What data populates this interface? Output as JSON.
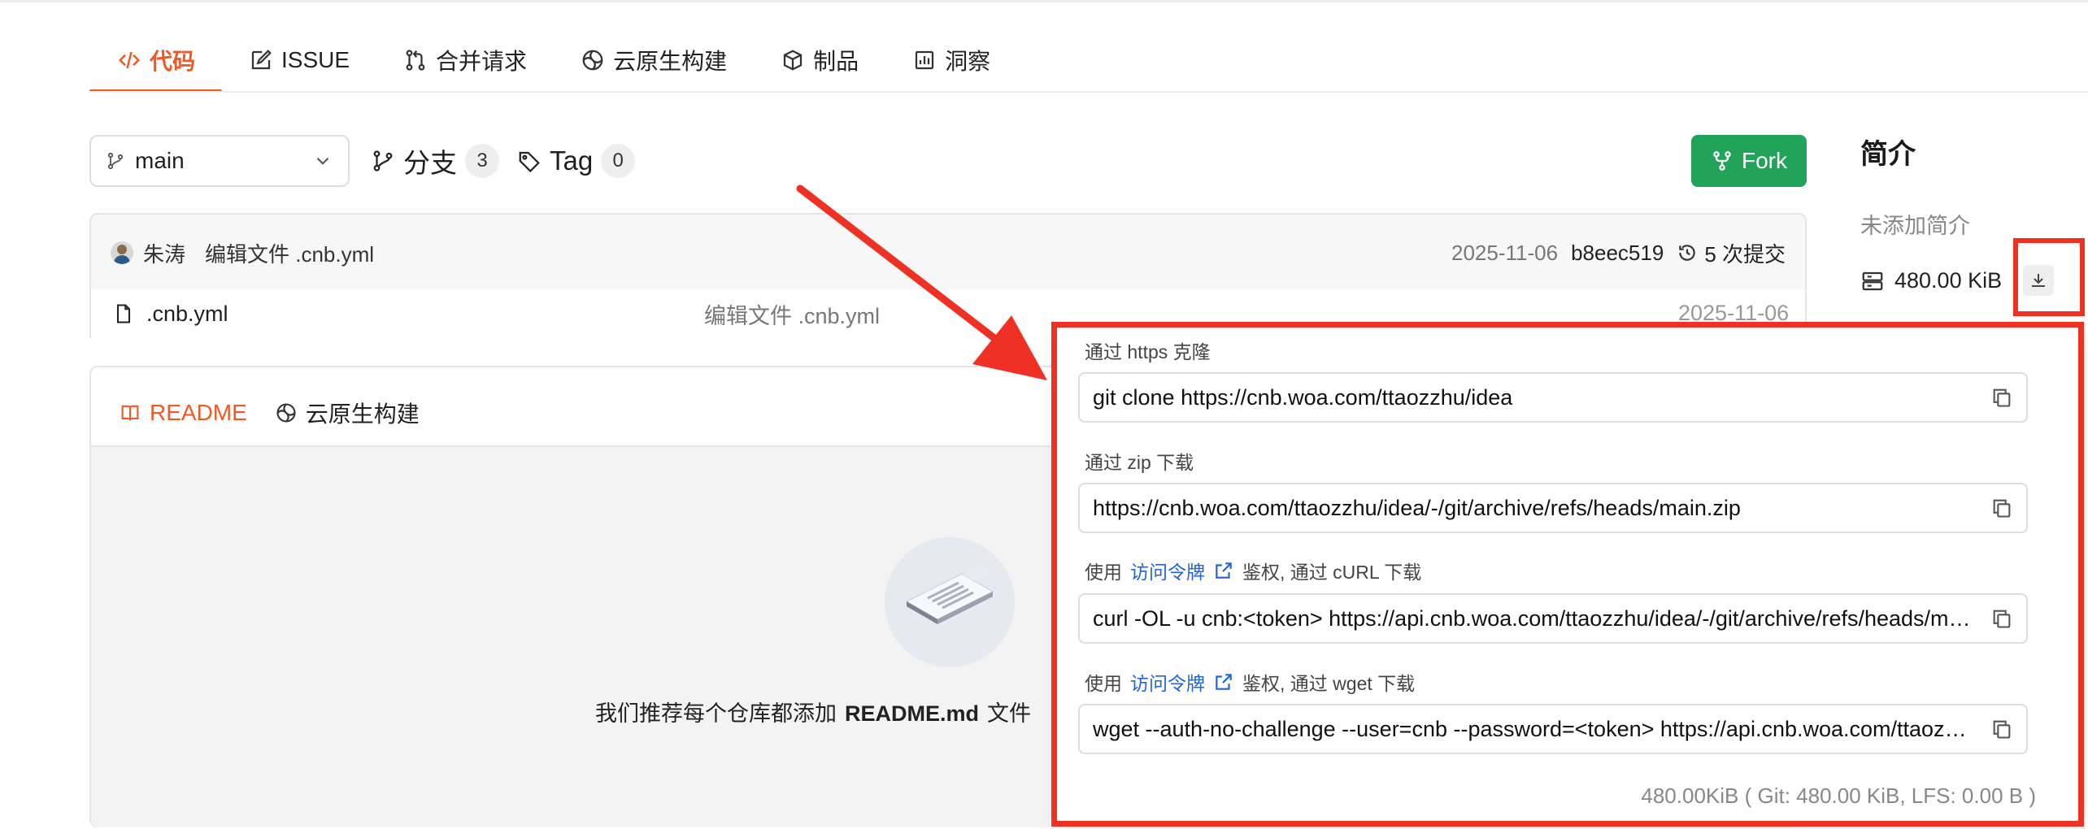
{
  "tabs": [
    {
      "label": "代码",
      "icon": "code-icon",
      "active": true
    },
    {
      "label": "ISSUE",
      "icon": "edit-icon"
    },
    {
      "label": "合并请求",
      "icon": "merge-icon"
    },
    {
      "label": "云原生构建",
      "icon": "build-icon"
    },
    {
      "label": "制品",
      "icon": "package-icon"
    },
    {
      "label": "洞察",
      "icon": "chart-icon"
    }
  ],
  "branch": {
    "selected": "main"
  },
  "branches": {
    "label": "分支",
    "count": "3"
  },
  "tags": {
    "label": "Tag",
    "count": "0"
  },
  "fork": {
    "label": "Fork"
  },
  "commit": {
    "author": "朱涛",
    "message": "编辑文件 .cnb.yml",
    "date": "2025-11-06",
    "hash": "b8eec519",
    "commits": "5 次提交"
  },
  "files": [
    {
      "name": ".cnb.yml",
      "message": "编辑文件 .cnb.yml",
      "date": "2025-11-06"
    }
  ],
  "readme": {
    "tabs": [
      {
        "label": "README",
        "active": true
      },
      {
        "label": "云原生构建"
      }
    ],
    "empty_prefix": "我们推荐每个仓库都添加",
    "empty_file": "README.md",
    "empty_suffix": "文件"
  },
  "sidebar": {
    "title": "简介",
    "description": "未添加简介",
    "size": "480.00 KiB"
  },
  "download_popup": {
    "https_label": "通过 https 克隆",
    "https_value": "git clone https://cnb.woa.com/ttaozzhu/idea",
    "zip_label": "通过 zip 下载",
    "zip_value": "https://cnb.woa.com/ttaozzhu/idea/-/git/archive/refs/heads/main.zip",
    "curl_prefix": "使用",
    "curl_link": "访问令牌",
    "curl_suffix": "鉴权, 通过 cURL 下载",
    "curl_value": "curl -OL -u cnb:<token> https://api.cnb.woa.com/ttaozzhu/idea/-/git/archive/refs/heads/main.zip",
    "wget_prefix": "使用",
    "wget_link": "访问令牌",
    "wget_suffix": "鉴权, 通过 wget 下载",
    "wget_value": "wget --auth-no-challenge --user=cnb --password=<token> https://api.cnb.woa.com/ttaozzhu/idea/-/git/archive/refs/heads/main.zip",
    "footer": "480.00KiB ( Git: 480.00 KiB, LFS: 0.00 B )"
  },
  "colors": {
    "accent": "#ef5a24",
    "fork": "#22a35a",
    "link": "#1f64d8",
    "highlight": "#ee3124"
  }
}
